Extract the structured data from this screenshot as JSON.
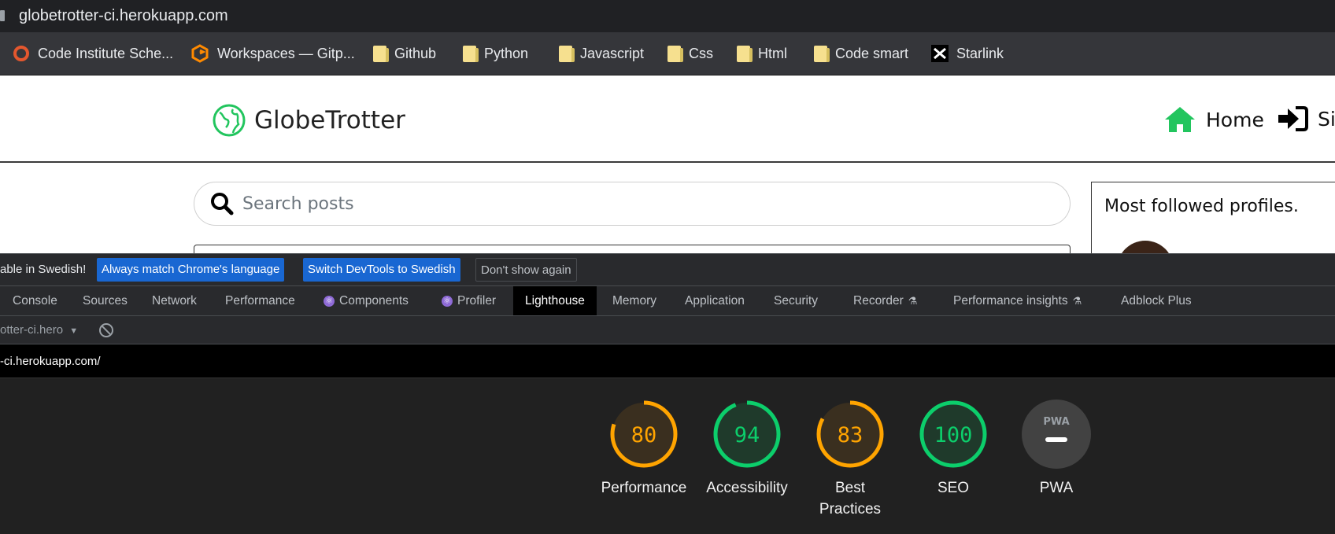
{
  "browser": {
    "url": "globetrotter-ci.herokuapp.com",
    "bookmarks": [
      {
        "label": "Code Institute Sche...",
        "icon": "code-institute-icon"
      },
      {
        "label": "Workspaces — Gitp...",
        "icon": "gitpod-icon"
      },
      {
        "label": "Github",
        "icon": "folder-icon"
      },
      {
        "label": "Python",
        "icon": "folder-icon"
      },
      {
        "label": "Javascript",
        "icon": "folder-icon"
      },
      {
        "label": "Css",
        "icon": "folder-icon"
      },
      {
        "label": "Html",
        "icon": "folder-icon"
      },
      {
        "label": "Code smart",
        "icon": "folder-icon"
      },
      {
        "label": "Starlink",
        "icon": "starlink-icon"
      }
    ]
  },
  "site": {
    "brand": "GlobeTrotter",
    "nav": {
      "home": "Home",
      "signin": "Si"
    },
    "search_placeholder": "Search posts",
    "sidebar_title": "Most followed profiles."
  },
  "devtools": {
    "infobar": {
      "message": "able in Swedish!",
      "match_button": "Always match Chrome's language",
      "switch_button": "Switch DevTools to Swedish",
      "dismiss_button": "Don't show again"
    },
    "tabs": [
      "Console",
      "Sources",
      "Network",
      "Performance",
      "Components",
      "Profiler",
      "Lighthouse",
      "Memory",
      "Application",
      "Security",
      "Recorder",
      "Performance insights",
      "Adblock Plus"
    ],
    "active_tab": "Lighthouse",
    "context_select": "otter-ci.hero",
    "report_url": "-ci.herokuapp.com/",
    "scores": [
      {
        "label": "Performance",
        "value": "80",
        "color": "#ffa400"
      },
      {
        "label": "Accessibility",
        "value": "94",
        "color": "#0cce6b"
      },
      {
        "label": "Best Practices",
        "value": "83",
        "color": "#ffa400"
      },
      {
        "label": "SEO",
        "value": "100",
        "color": "#0cce6b"
      },
      {
        "label": "PWA",
        "value": "PWA",
        "color": "#9aa0a6"
      }
    ]
  }
}
